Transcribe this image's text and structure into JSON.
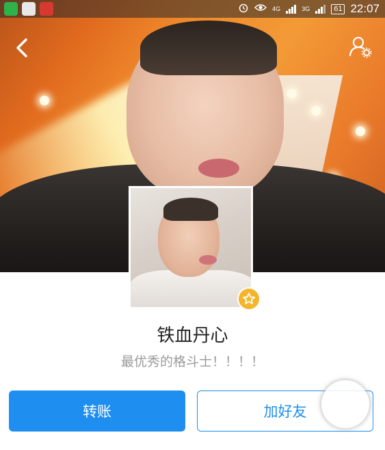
{
  "status_bar": {
    "time": "22:07",
    "battery": "61",
    "network_primary": "4G",
    "network_secondary": "3G",
    "app_icons": [
      "wechat-icon",
      "app-icon",
      "news-icon"
    ],
    "status_icons": [
      "alarm-icon",
      "eye-icon"
    ]
  },
  "profile": {
    "nickname": "铁血丹心",
    "signature": "最优秀的格斗士！！！！",
    "avatar_badge_icon": "star-badge-icon"
  },
  "actions": {
    "transfer_label": "转账",
    "add_friend_label": "加好友"
  },
  "colors": {
    "accent": "#1e8ff0",
    "badge": "#f5b52b"
  }
}
